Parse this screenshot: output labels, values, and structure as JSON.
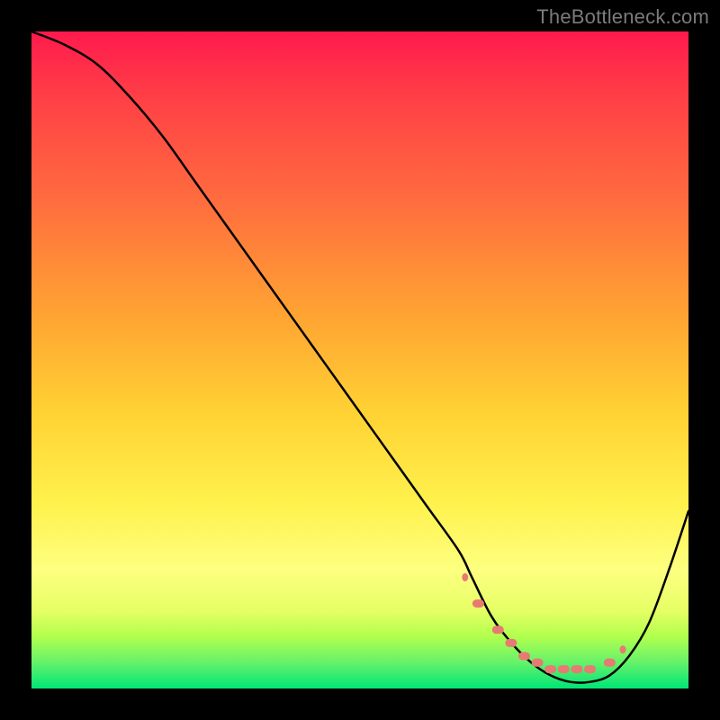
{
  "watermark": "TheBottleneck.com",
  "colors": {
    "frame": "#000000",
    "curve": "#000000",
    "marker": "#e77a72",
    "watermark_text": "#7b7b7b"
  },
  "chart_data": {
    "type": "line",
    "title": "",
    "xlabel": "",
    "ylabel": "",
    "xlim": [
      0,
      100
    ],
    "ylim": [
      0,
      100
    ],
    "grid": false,
    "series": [
      {
        "name": "bottleneck-curve",
        "x": [
          0,
          5,
          10,
          15,
          20,
          25,
          30,
          35,
          40,
          45,
          50,
          55,
          60,
          65,
          67,
          70,
          73,
          76,
          79,
          82,
          85,
          88,
          91,
          94,
          97,
          100
        ],
        "values": [
          100,
          98,
          95,
          90,
          84,
          77,
          70,
          63,
          56,
          49,
          42,
          35,
          28,
          21,
          17,
          11,
          7,
          4,
          2,
          1,
          1,
          2,
          5,
          10,
          18,
          27
        ]
      }
    ],
    "markers": {
      "name": "trough-dots",
      "x": [
        66,
        68,
        71,
        73,
        75,
        77,
        79,
        81,
        83,
        85,
        88,
        90
      ],
      "values": [
        17,
        13,
        9,
        7,
        5,
        4,
        3,
        3,
        3,
        3,
        4,
        6
      ]
    }
  }
}
